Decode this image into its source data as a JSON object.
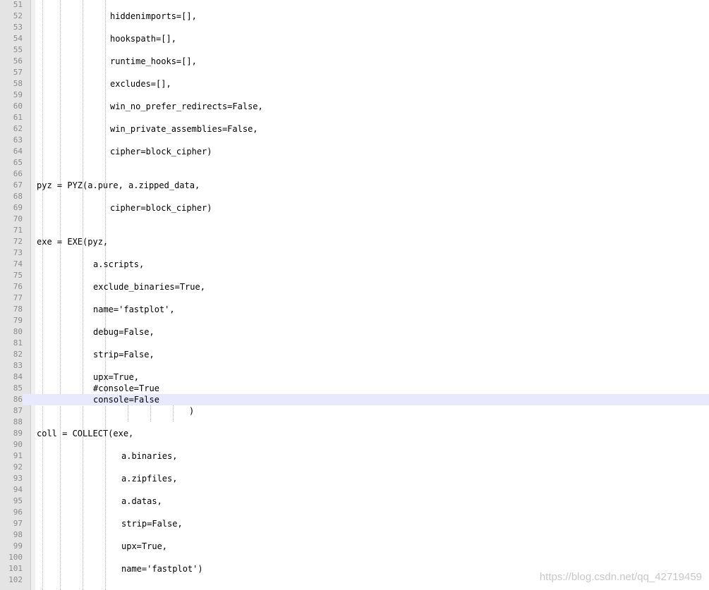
{
  "editor": {
    "current_line": 86,
    "lines": [
      {
        "n": "51",
        "text": "",
        "indent": 0
      },
      {
        "n": "52",
        "text": "hiddenimports=[],",
        "indent": 156
      },
      {
        "n": "53",
        "text": "",
        "indent": 0
      },
      {
        "n": "54",
        "text": "hookspath=[],",
        "indent": 156
      },
      {
        "n": "55",
        "text": "",
        "indent": 0
      },
      {
        "n": "56",
        "text": "runtime_hooks=[],",
        "indent": 156
      },
      {
        "n": "57",
        "text": "",
        "indent": 0
      },
      {
        "n": "58",
        "text": "excludes=[],",
        "indent": 156
      },
      {
        "n": "59",
        "text": "",
        "indent": 0
      },
      {
        "n": "60",
        "text": "win_no_prefer_redirects=False,",
        "indent": 156
      },
      {
        "n": "61",
        "text": "",
        "indent": 0
      },
      {
        "n": "62",
        "text": "win_private_assemblies=False,",
        "indent": 156
      },
      {
        "n": "63",
        "text": "",
        "indent": 0
      },
      {
        "n": "64",
        "text": "cipher=block_cipher)",
        "indent": 156
      },
      {
        "n": "65",
        "text": "",
        "indent": 0
      },
      {
        "n": "66",
        "text": "",
        "indent": 0
      },
      {
        "n": "67",
        "text": "pyz = PYZ(a.pure, a.zipped_data,",
        "indent": 52
      },
      {
        "n": "68",
        "text": "",
        "indent": 0
      },
      {
        "n": "69",
        "text": "cipher=block_cipher)",
        "indent": 156
      },
      {
        "n": "70",
        "text": "",
        "indent": 0
      },
      {
        "n": "71",
        "text": "",
        "indent": 0
      },
      {
        "n": "72",
        "text": "exe = EXE(pyz,",
        "indent": 52
      },
      {
        "n": "73",
        "text": "",
        "indent": 0
      },
      {
        "n": "74",
        "text": "a.scripts,",
        "indent": 132
      },
      {
        "n": "75",
        "text": "",
        "indent": 0
      },
      {
        "n": "76",
        "text": "exclude_binaries=True,",
        "indent": 132
      },
      {
        "n": "77",
        "text": "",
        "indent": 0
      },
      {
        "n": "78",
        "text": "name='fastplot',",
        "indent": 132
      },
      {
        "n": "79",
        "text": "",
        "indent": 0
      },
      {
        "n": "80",
        "text": "debug=False,",
        "indent": 132
      },
      {
        "n": "81",
        "text": "",
        "indent": 0
      },
      {
        "n": "82",
        "text": "strip=False,",
        "indent": 132
      },
      {
        "n": "83",
        "text": "",
        "indent": 0
      },
      {
        "n": "84",
        "text": "upx=True,",
        "indent": 132
      },
      {
        "n": "85",
        "text": "#console=True",
        "indent": 132
      },
      {
        "n": "86",
        "text": "console=False",
        "indent": 132
      },
      {
        "n": "87",
        "text": ")",
        "indent": 268
      },
      {
        "n": "88",
        "text": "",
        "indent": 0
      },
      {
        "n": "89",
        "text": "coll = COLLECT(exe,",
        "indent": 52
      },
      {
        "n": "90",
        "text": "",
        "indent": 0
      },
      {
        "n": "91",
        "text": "a.binaries,",
        "indent": 172
      },
      {
        "n": "92",
        "text": "",
        "indent": 0
      },
      {
        "n": "93",
        "text": "a.zipfiles,",
        "indent": 172
      },
      {
        "n": "94",
        "text": "",
        "indent": 0
      },
      {
        "n": "95",
        "text": "a.datas,",
        "indent": 172
      },
      {
        "n": "96",
        "text": "",
        "indent": 0
      },
      {
        "n": "97",
        "text": "strip=False,",
        "indent": 172
      },
      {
        "n": "98",
        "text": "",
        "indent": 0
      },
      {
        "n": "99",
        "text": "upx=True,",
        "indent": 172
      },
      {
        "n": "100",
        "text": "",
        "indent": 0
      },
      {
        "n": "101",
        "text": "name='fastplot')",
        "indent": 172
      },
      {
        "n": "102",
        "text": "",
        "indent": 0
      }
    ]
  },
  "watermark": "https://blog.csdn.net/qq_42719459"
}
